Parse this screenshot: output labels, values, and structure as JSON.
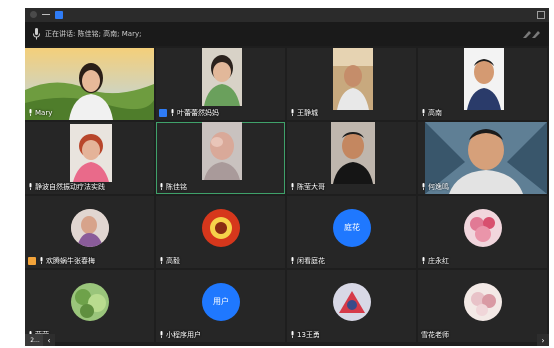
{
  "speaker_bar": {
    "text": "正在讲话: 陈佳铭; 高南; Mary;"
  },
  "pager": {
    "page_text": "2...",
    "prev_arrow": "‹",
    "next_arrow": "›"
  },
  "participants": [
    {
      "name": "Mary"
    },
    {
      "name": "叶蕾蕾然妈妈"
    },
    {
      "name": "王静城"
    },
    {
      "name": "高南"
    },
    {
      "name": "静波自然振动疗法实践"
    },
    {
      "name": "陈佳铭"
    },
    {
      "name": "陈莹大哥"
    },
    {
      "name": "何逸鸣"
    },
    {
      "name": "欢腾蜗牛张春梅"
    },
    {
      "name": "高毅"
    },
    {
      "name": "闲看庭花",
      "avatar_text": "庭花"
    },
    {
      "name": "庄永红"
    },
    {
      "name": "莹莹"
    },
    {
      "name": "小程序用户",
      "avatar_text": "用户"
    },
    {
      "name": "13王勇"
    },
    {
      "name": "雪花老师"
    }
  ],
  "colors": {
    "window_bg": "#1e1e1e",
    "tile_bg": "#262626",
    "accent_blue": "#1f78ff",
    "host_orange": "#f2a33a",
    "active_green": "#3fa16a"
  }
}
